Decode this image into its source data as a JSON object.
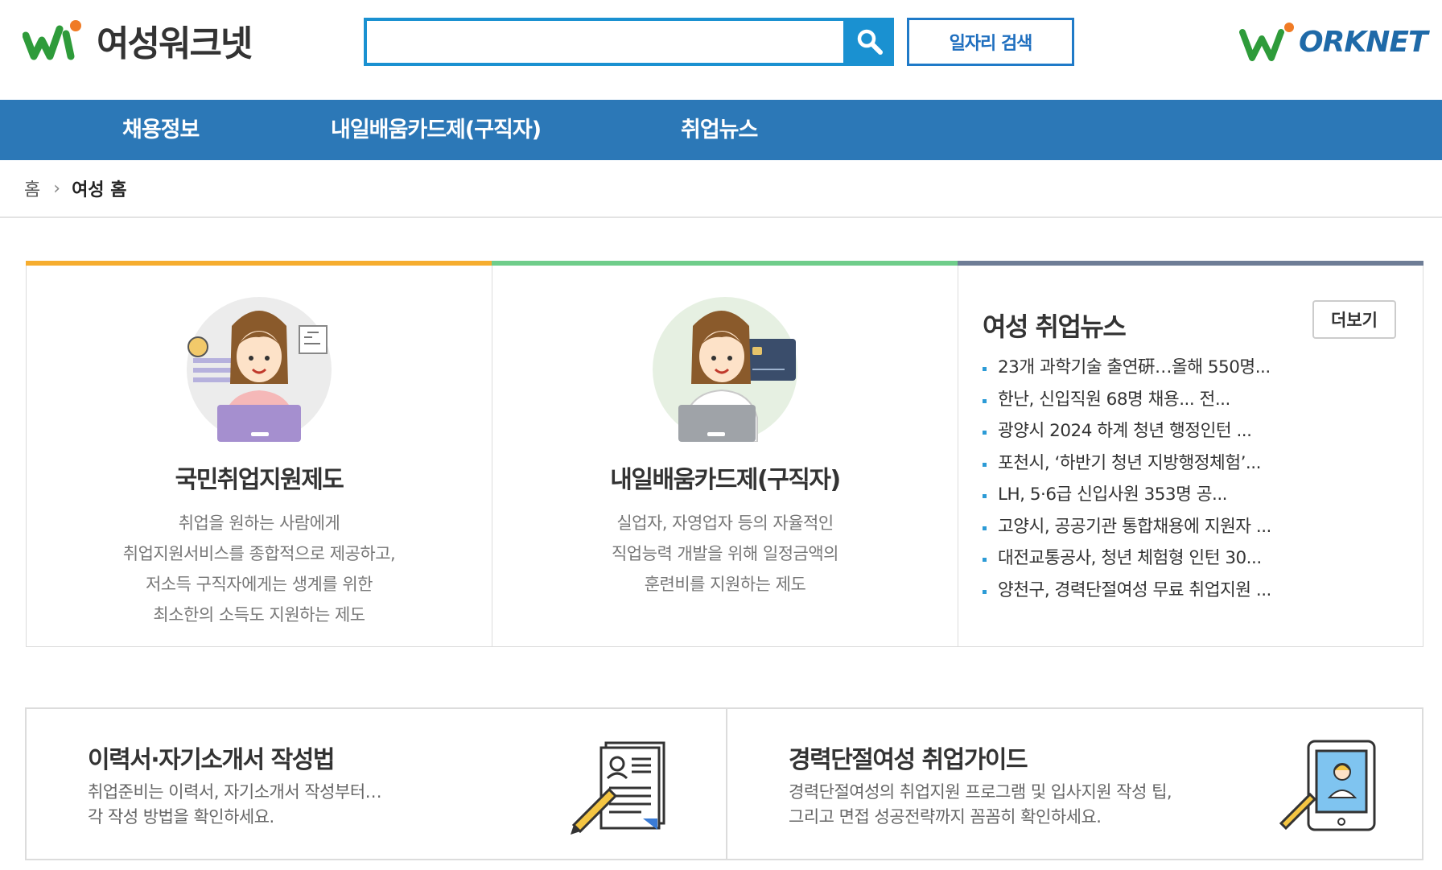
{
  "header": {
    "logo_text": "여성워크넷",
    "search_value": "",
    "job_search_label": "일자리 검색",
    "worknet_logo_text": "ORKNET",
    "brand_green": "#2e9b3a",
    "brand_orange": "#f07b25",
    "brand_blue": "#1f6aa8"
  },
  "nav": {
    "color": "#2c78b7",
    "items": [
      {
        "label": "채용정보"
      },
      {
        "label": "내일배움카드제(구직자)"
      },
      {
        "label": "취업뉴스"
      }
    ]
  },
  "breadcrumb": {
    "home": "홈",
    "current": "여성 홈"
  },
  "cards": [
    {
      "title": "국민취업지원제도",
      "desc": [
        "취업을 원하는 사람에게",
        "취업지원서비스를 종합적으로 제공하고,",
        "저소득 구직자에게는 생계를 위한",
        "최소한의 소득도 지원하는 제도"
      ],
      "accent": "#f6ad2f",
      "icon": "woman-laptop-icon"
    },
    {
      "title": "내일배움카드제(구직자)",
      "desc": [
        "실업자, 자영업자 등의 자율적인",
        "직업능력 개발을 위해 일정금액의",
        "훈련비를 지원하는 제도"
      ],
      "accent": "#6fcd8a",
      "icon": "woman-card-icon"
    }
  ],
  "news": {
    "title": "여성 취업뉴스",
    "more_label": "더보기",
    "accent": "#6e7d96",
    "items": [
      "23개 과학기술 출연硏…올해 550명...",
      "한난, 신입직원 68명 채용... 전...",
      "광양시 2024 하계 청년 행정인턴 ...",
      "포천시, ‘하반기 청년 지방행정체험’...",
      "LH, 5·6급 신입사원 353명 공...",
      "고양시, 공공기관 통합채용에 지원자 ...",
      "대전교통공사, 청년 체험형 인턴 30...",
      "양천구, 경력단절여성 무료 취업지원 ..."
    ]
  },
  "bottom": [
    {
      "title": "이력서·자기소개서 작성법",
      "desc": [
        "취업준비는 이력서, 자기소개서 작성부터…",
        "각 작성 방법을 확인하세요."
      ],
      "icon": "resume-pencil-icon"
    },
    {
      "title": "경력단절여성 취업가이드",
      "desc": [
        "경력단절여성의 취업지원 프로그램 및 입사지원 작성 팁,",
        "그리고 면접 성공전략까지 꼼꼼히 확인하세요."
      ],
      "icon": "tablet-guide-icon"
    }
  ]
}
